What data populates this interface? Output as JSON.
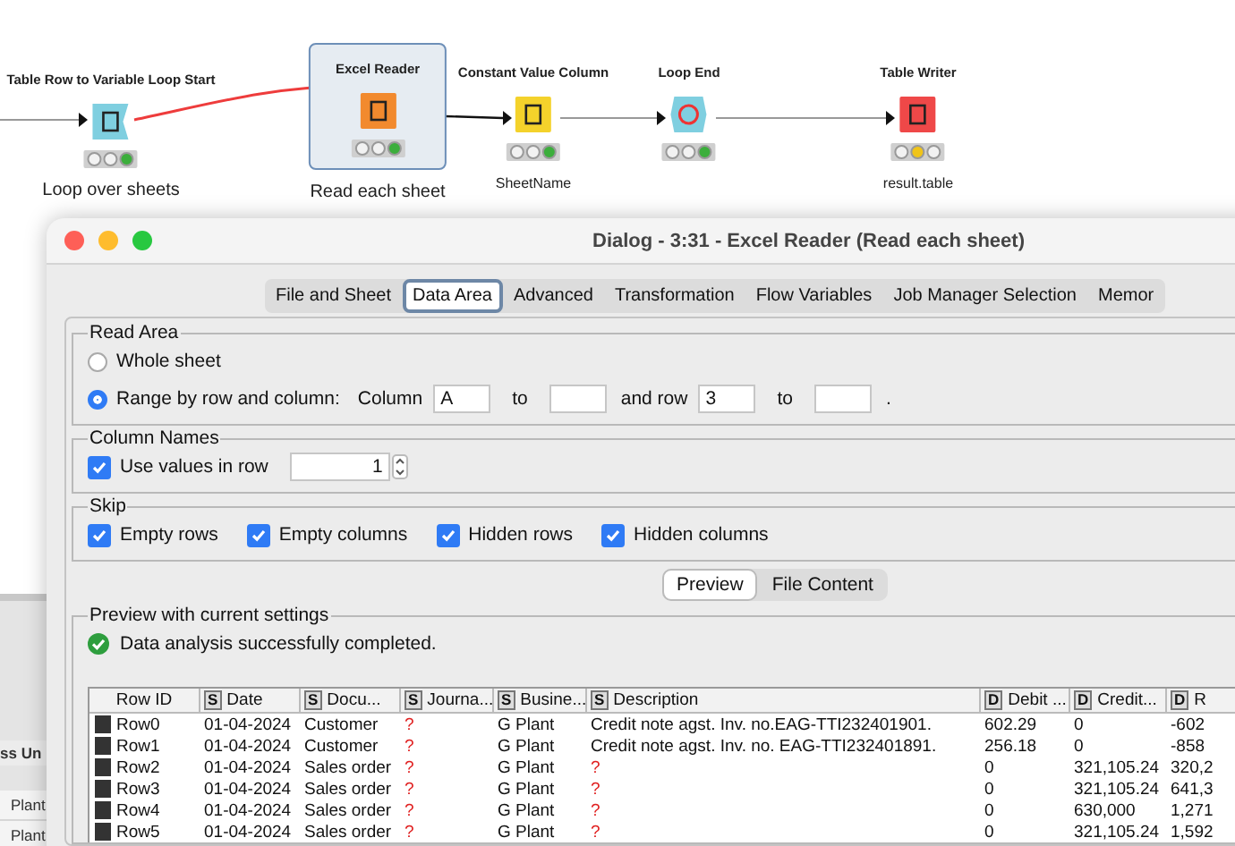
{
  "canvas": {
    "nodes": [
      {
        "title": "Table Row to Variable Loop Start",
        "kind": "loop_start",
        "executed": true,
        "selected": false,
        "annotation": "Loop over sheets",
        "emphasis": true
      },
      {
        "title": "Excel Reader",
        "kind": "source",
        "executed": true,
        "selected": true,
        "annotation": "Read each sheet",
        "emphasis": true
      },
      {
        "title": "Constant Value Column",
        "kind": "manipulator",
        "executed": true,
        "selected": false,
        "annotation": "SheetName",
        "emphasis": false
      },
      {
        "title": "Loop End",
        "kind": "loop_end",
        "executed": true,
        "selected": false
      },
      {
        "title": "Table Writer",
        "kind": "sink",
        "executed": false,
        "selected": false,
        "annotation": "result.table",
        "emphasis": false
      }
    ]
  },
  "background_panel": {
    "header": "ss Un",
    "cells": [
      "Plant",
      "Plant"
    ]
  },
  "dialog": {
    "title": "Dialog - 3:31 - Excel Reader (Read each sheet)",
    "tabs": [
      {
        "label": "File and Sheet",
        "selected": false
      },
      {
        "label": "Data Area",
        "selected": true
      },
      {
        "label": "Advanced",
        "selected": false
      },
      {
        "label": "Transformation",
        "selected": false
      },
      {
        "label": "Flow Variables",
        "selected": false
      },
      {
        "label": "Job Manager Selection",
        "selected": false
      },
      {
        "label": "Memor",
        "selected": false
      }
    ],
    "read_area": {
      "legend": "Read Area",
      "options": [
        {
          "label": "Whole sheet",
          "selected": false
        },
        {
          "label": "Range by row and column:",
          "selected": true
        }
      ],
      "column_label": "Column",
      "column_from": "A",
      "column_to_label": "to",
      "row_label": "and row",
      "row_from": "3",
      "row_to_label": "to",
      "end": "."
    },
    "column_names": {
      "legend": "Column Names",
      "label": "Use values in row",
      "checked": true,
      "row_value": "1"
    },
    "skip": {
      "legend": "Skip",
      "options": [
        {
          "label": "Empty rows",
          "checked": true
        },
        {
          "label": "Empty columns",
          "checked": true
        },
        {
          "label": "Hidden rows",
          "checked": true
        },
        {
          "label": "Hidden columns",
          "checked": true
        }
      ]
    },
    "preview_tabs": [
      {
        "label": "Preview",
        "selected": true
      },
      {
        "label": "File Content",
        "selected": false
      }
    ],
    "preview": {
      "legend": "Preview with current settings",
      "status": "Data analysis successfully completed.",
      "columns": [
        {
          "name": "Row ID"
        },
        {
          "type": "S",
          "name": "Date"
        },
        {
          "type": "S",
          "name": "Docu..."
        },
        {
          "type": "S",
          "name": "Journa..."
        },
        {
          "type": "S",
          "name": "Busine..."
        },
        {
          "type": "S",
          "name": "Description"
        },
        {
          "type": "D",
          "name": "Debit ..."
        },
        {
          "type": "D",
          "name": "Credit..."
        },
        {
          "type": "D",
          "name": "R"
        }
      ],
      "rows": [
        [
          "Row0",
          "01-04-2024",
          "Customer",
          {
            "text": "?",
            "missing": true
          },
          "G Plant",
          "Credit note agst. Inv. no.EAG-TTI232401901.",
          "602.29",
          "0",
          "-602"
        ],
        [
          "Row1",
          "01-04-2024",
          "Customer",
          {
            "text": "?",
            "missing": true
          },
          "G Plant",
          "Credit note agst. Inv. no. EAG-TTI232401891.",
          "256.18",
          "0",
          "-858"
        ],
        [
          "Row2",
          "01-04-2024",
          "Sales order",
          {
            "text": "?",
            "missing": true
          },
          "G Plant",
          {
            "text": "?",
            "missing": true
          },
          "0",
          "321,105.24",
          "320,2"
        ],
        [
          "Row3",
          "01-04-2024",
          "Sales order",
          {
            "text": "?",
            "missing": true
          },
          "G Plant",
          {
            "text": "?",
            "missing": true
          },
          "0",
          "321,105.24",
          "641,3"
        ],
        [
          "Row4",
          "01-04-2024",
          "Sales order",
          {
            "text": "?",
            "missing": true
          },
          "G Plant",
          {
            "text": "?",
            "missing": true
          },
          "0",
          "630,000",
          "1,271"
        ],
        [
          "Row5",
          "01-04-2024",
          "Sales order",
          {
            "text": "?",
            "missing": true
          },
          "G Plant",
          {
            "text": "?",
            "missing": true
          },
          "0",
          "321,105.24",
          "1,592"
        ]
      ]
    }
  }
}
